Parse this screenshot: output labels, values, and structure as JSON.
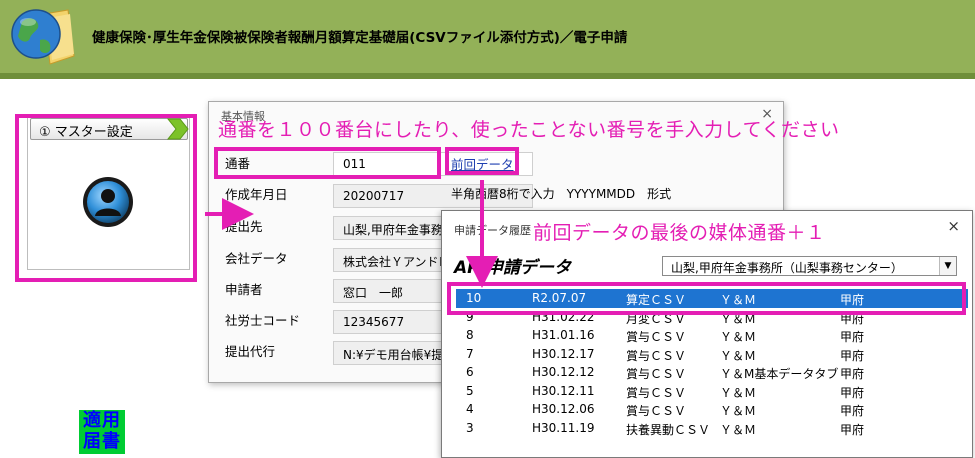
{
  "header": {
    "title": "健康保険･厚生年金保険被保険者報酬月額算定基礎届(CSVファイル添付方式)／電子申請"
  },
  "master": {
    "tab_label": "① マスター設定"
  },
  "badge": {
    "line1": "適用",
    "line2": "届書"
  },
  "basic_dialog": {
    "title": "基本情報",
    "close": "×",
    "fields": [
      {
        "label": "通番",
        "value": "011"
      },
      {
        "label": "作成年月日",
        "value": "20200717"
      },
      {
        "label": "提出先",
        "value": "山梨,甲府年金事務所"
      },
      {
        "label": "会社データ",
        "value": "株式会社ＹアンドＭ"
      },
      {
        "label": "申請者",
        "value": "窓口　一郎"
      },
      {
        "label": "社労士コード",
        "value": "12345677"
      },
      {
        "label": "提出代行",
        "value": "N:¥デモ用台帳¥提"
      }
    ],
    "prev_link": "前回データ",
    "date_hint": "半角西暦8桁で入力　YYYYMMDD　形式"
  },
  "annotations": {
    "top": "通番を１００番台にしたり、使ったことない番号を手入力してください",
    "history": "前回データの最後の媒体通番＋１"
  },
  "history_dialog": {
    "title": "申請データ履歴",
    "close": "×",
    "api_title": "API申請データ",
    "office_select": "山梨,甲府年金事務所（山梨事務センター）",
    "select_arrow": "▼",
    "rows": [
      {
        "no": "10",
        "date": "R2.07.07",
        "type": "算定ＣＳＶ",
        "client": "Ｙ＆Ｍ",
        "office": "甲府",
        "selected": true
      },
      {
        "no": "9",
        "date": "H31.02.22",
        "type": "月変ＣＳＶ",
        "client": "Ｙ＆Ｍ",
        "office": "甲府"
      },
      {
        "no": "8",
        "date": "H31.01.16",
        "type": "賞与ＣＳＶ",
        "client": "Ｙ＆Ｍ",
        "office": "甲府"
      },
      {
        "no": "7",
        "date": "H30.12.17",
        "type": "賞与ＣＳＶ",
        "client": "Ｙ＆Ｍ",
        "office": "甲府"
      },
      {
        "no": "6",
        "date": "H30.12.12",
        "type": "賞与ＣＳＶ",
        "client": "Ｙ＆M基本データタブ",
        "office": "甲府"
      },
      {
        "no": "5",
        "date": "H30.12.11",
        "type": "賞与ＣＳＶ",
        "client": "Ｙ＆Ｍ",
        "office": "甲府"
      },
      {
        "no": "4",
        "date": "H30.12.06",
        "type": "賞与ＣＳＶ",
        "client": "Ｙ＆Ｍ",
        "office": "甲府"
      },
      {
        "no": "3",
        "date": "H30.11.19",
        "type": "扶養異動ＣＳＶ",
        "client": "Ｙ＆Ｍ",
        "office": "甲府"
      }
    ]
  },
  "colors": {
    "header_bg": "#93b158",
    "annotation": "#e41eb4",
    "selection": "#1e74d1",
    "link": "#1f3fb0"
  }
}
